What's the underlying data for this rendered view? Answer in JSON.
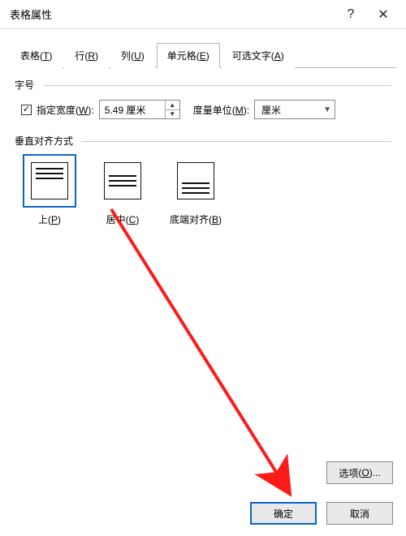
{
  "titlebar": {
    "title": "表格属性",
    "help": "?",
    "close": "✕"
  },
  "tabs": {
    "table": {
      "label": "表格",
      "hotkey": "T"
    },
    "row": {
      "label": "行",
      "hotkey": "R"
    },
    "column": {
      "label": "列",
      "hotkey": "U"
    },
    "cell": {
      "label": "单元格",
      "hotkey": "E"
    },
    "alt": {
      "label": "可选文字",
      "hotkey": "A"
    }
  },
  "size": {
    "group_label": "字号",
    "pref_width_label": "指定宽度",
    "pref_width_hotkey": "W",
    "width_value": "5.49 厘米",
    "unit_label": "度量单位",
    "unit_hotkey": "M",
    "unit_value": "厘米"
  },
  "valign": {
    "group_label": "垂直对齐方式",
    "top": {
      "label": "上",
      "hotkey": "P"
    },
    "center": {
      "label": "居中",
      "hotkey": "C"
    },
    "bottom": {
      "label": "底端对齐",
      "hotkey": "B"
    }
  },
  "footer": {
    "options_label": "选项",
    "options_hotkey": "O",
    "ok": "确定",
    "cancel": "取消"
  }
}
